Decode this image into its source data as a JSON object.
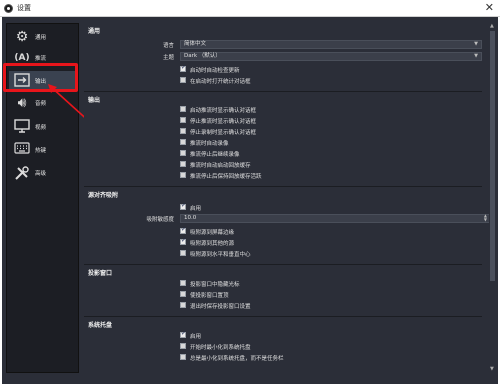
{
  "window": {
    "title": "设置"
  },
  "sidebar": {
    "items": [
      {
        "label": "通用",
        "icon": "gear-icon"
      },
      {
        "label": "推流",
        "icon": "broadcast-icon"
      },
      {
        "label": "输出",
        "icon": "output-icon"
      },
      {
        "label": "音频",
        "icon": "speaker-icon"
      },
      {
        "label": "视频",
        "icon": "monitor-icon"
      },
      {
        "label": "热键",
        "icon": "keyboard-icon"
      },
      {
        "label": "高级",
        "icon": "tools-icon"
      }
    ],
    "active_index": 2
  },
  "general": {
    "title": "通用",
    "language_label": "语言",
    "language_value": "简体中文",
    "theme_label": "主题",
    "theme_value": "Dark （默认）",
    "checks": [
      {
        "label": "启动时自动检查更新",
        "checked": true
      },
      {
        "label": "在启动时打开统计对话框",
        "checked": false
      }
    ]
  },
  "output": {
    "title": "输出",
    "checks": [
      {
        "label": "启动推流时显示确认对话框",
        "checked": false
      },
      {
        "label": "停止推流时显示确认对话框",
        "checked": false
      },
      {
        "label": "停止录制时显示确认对话框",
        "checked": false
      },
      {
        "label": "推流时自动录像",
        "checked": false
      },
      {
        "label": "推流停止后继续录像",
        "checked": false
      },
      {
        "label": "推流时自动启动回放缓存",
        "checked": false
      },
      {
        "label": "推流停止后保持回放缓存活跃",
        "checked": false
      }
    ]
  },
  "snapping": {
    "title": "源对齐吸附",
    "enable_label": "启用",
    "enable_checked": true,
    "sensitivity_label": "吸附敏感度",
    "sensitivity_value": "10.0",
    "checks": [
      {
        "label": "吸附源到屏幕边缘",
        "checked": true
      },
      {
        "label": "吸附源到其他的源",
        "checked": true
      },
      {
        "label": "吸附源到水平和垂直中心",
        "checked": false
      }
    ]
  },
  "projectors": {
    "title": "投影窗口",
    "checks": [
      {
        "label": "投影窗口中隐藏光标",
        "checked": false
      },
      {
        "label": "使投影窗口置顶",
        "checked": false
      },
      {
        "label": "退出时保存投影窗口设置",
        "checked": false
      }
    ]
  },
  "tray": {
    "title": "系统托盘",
    "checks": [
      {
        "label": "启用",
        "checked": true
      },
      {
        "label": "开始时最小化到系统托盘",
        "checked": false
      },
      {
        "label": "总是最小化到系统托盘，而不是任务栏",
        "checked": false
      }
    ]
  },
  "colors": {
    "accent_red": "#e8151b",
    "background": "#2b2e38",
    "sidebar": "#1c1e24"
  }
}
